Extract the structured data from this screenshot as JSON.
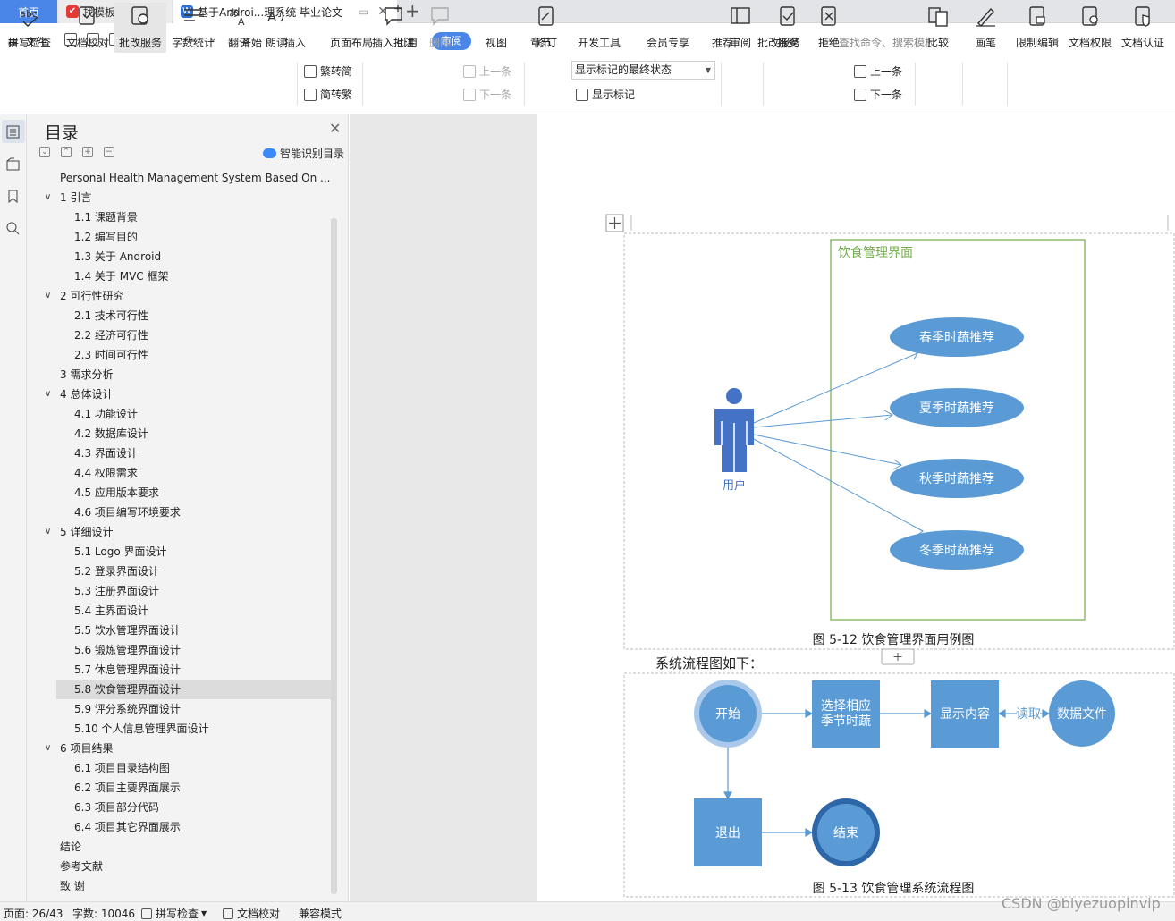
{
  "tabs": {
    "home": "首页",
    "template": "找模板",
    "doc": "基于Androi...理系统 毕业论文"
  },
  "menu": {
    "file": "文件",
    "items": [
      "开始",
      "插入",
      "页面布局",
      "引用",
      "审阅",
      "视图",
      "章节",
      "开发工具",
      "会员专享",
      "推荐",
      "批改服务"
    ],
    "active": "审阅",
    "search_placeholder": "查找命令、搜索模板"
  },
  "ribbon": {
    "spell": "拼写检查",
    "proof": "文档校对",
    "correct": "批改服务",
    "wordcount": "字数统计",
    "translate": "翻译",
    "read": "朗读",
    "trad": "繁转简",
    "simp": "简转繁",
    "insert_comment": "插入批注",
    "delete": "删除",
    "prev_comment": "上一条",
    "next_comment": "下一条",
    "revise": "修订",
    "markup_state": "显示标记的最终状态",
    "show_markup": "显示标记",
    "review": "审阅",
    "accept": "接受",
    "reject": "拒绝",
    "prev": "上一条",
    "next": "下一条",
    "compare": "比较",
    "pen": "画笔",
    "restrict": "限制编辑",
    "perm": "文档权限",
    "cert": "文档认证"
  },
  "toc": {
    "title": "目录",
    "smart": "智能识别目录",
    "items": [
      {
        "text": "Personal Health Management System Based On ...",
        "level": 0,
        "chev": false
      },
      {
        "text": "1   引言",
        "level": 0,
        "chev": true
      },
      {
        "text": "1.1   课题背景",
        "level": 1,
        "chev": false
      },
      {
        "text": "1.2   编写目的",
        "level": 1,
        "chev": false
      },
      {
        "text": "1.3   关于 Android",
        "level": 1,
        "chev": false
      },
      {
        "text": "1.4   关于 MVC 框架",
        "level": 1,
        "chev": false
      },
      {
        "text": "2   可行性研究",
        "level": 0,
        "chev": true
      },
      {
        "text": "2.1   技术可行性",
        "level": 1,
        "chev": false
      },
      {
        "text": "2.2   经济可行性",
        "level": 1,
        "chev": false
      },
      {
        "text": "2.3   时间可行性",
        "level": 1,
        "chev": false
      },
      {
        "text": "3   需求分析",
        "level": 0,
        "chev": false
      },
      {
        "text": "4   总体设计",
        "level": 0,
        "chev": true
      },
      {
        "text": "4.1   功能设计",
        "level": 1,
        "chev": false
      },
      {
        "text": "4.2   数据库设计",
        "level": 1,
        "chev": false
      },
      {
        "text": "4.3   界面设计",
        "level": 1,
        "chev": false
      },
      {
        "text": "4.4   权限需求",
        "level": 1,
        "chev": false
      },
      {
        "text": "4.5   应用版本要求",
        "level": 1,
        "chev": false
      },
      {
        "text": "4.6   项目编写环境要求",
        "level": 1,
        "chev": false
      },
      {
        "text": "5   详细设计",
        "level": 0,
        "chev": true
      },
      {
        "text": "5.1   Logo 界面设计",
        "level": 1,
        "chev": false
      },
      {
        "text": "5.2   登录界面设计",
        "level": 1,
        "chev": false
      },
      {
        "text": "5.3   注册界面设计",
        "level": 1,
        "chev": false
      },
      {
        "text": "5.4   主界面设计",
        "level": 1,
        "chev": false
      },
      {
        "text": "5.5   饮水管理界面设计",
        "level": 1,
        "chev": false
      },
      {
        "text": "5.6   锻炼管理界面设计",
        "level": 1,
        "chev": false
      },
      {
        "text": "5.7   休息管理界面设计",
        "level": 1,
        "chev": false
      },
      {
        "text": "5.8   饮食管理界面设计",
        "level": 1,
        "chev": false,
        "selected": true
      },
      {
        "text": "5.9   评分系统界面设计",
        "level": 1,
        "chev": false
      },
      {
        "text": "5.10   个人信息管理界面设计",
        "level": 1,
        "chev": false
      },
      {
        "text": "6   项目结果",
        "level": 0,
        "chev": true
      },
      {
        "text": "6.1   项目目录结构图",
        "level": 1,
        "chev": false
      },
      {
        "text": "6.2   项目主要界面展示",
        "level": 1,
        "chev": false
      },
      {
        "text": "6.3   项目部分代码",
        "level": 1,
        "chev": false
      },
      {
        "text": "6.4   项目其它界面展示",
        "level": 1,
        "chev": false
      },
      {
        "text": "结论",
        "level": 0,
        "chev": false
      },
      {
        "text": "参考文献",
        "level": 0,
        "chev": false
      },
      {
        "text": "致   谢",
        "level": 0,
        "chev": false
      }
    ]
  },
  "usecase": {
    "boundary": "饮食管理界面",
    "actor": "用户",
    "cases": [
      "春季时蔬推荐",
      "夏季时蔬推荐",
      "秋季时蔬推荐",
      "冬季时蔬推荐"
    ],
    "caption": "图 5-12   饮食管理界面用例图"
  },
  "body_text": "系统流程图如下：",
  "flow": {
    "start": "开始",
    "select_line1": "选择相应",
    "select_line2": "季节时蔬",
    "show": "显示内容",
    "read": "读取",
    "datafile": "数据文件",
    "exit": "退出",
    "end": "结束",
    "caption": "图 5-13   饮食管理系统流程图"
  },
  "status": {
    "page": "页面: 26/43",
    "words": "字数: 10046",
    "spell": "拼写检查",
    "proof": "文档校对",
    "compat": "兼容模式"
  },
  "watermark": "CSDN @biyezuopinvip",
  "colors": {
    "accent": "#4a86e8",
    "shape_fill": "#5b9bd5",
    "actor": "#4472c4",
    "boundary": "#70ad47"
  }
}
